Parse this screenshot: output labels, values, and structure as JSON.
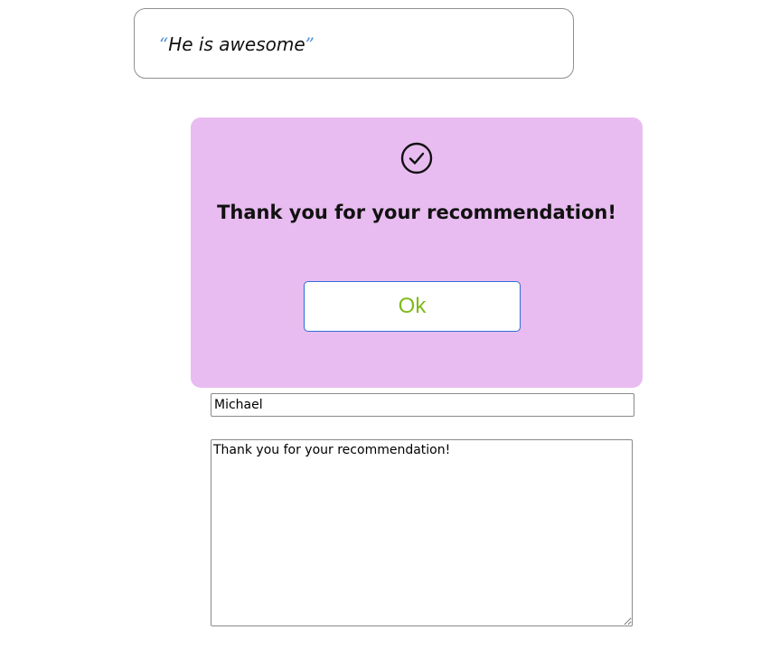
{
  "quote": {
    "open_mark": "“",
    "text": "He is awesome",
    "close_mark": "”"
  },
  "modal": {
    "icon": "check-circle-icon",
    "title": "Thank you for your recommendation!",
    "ok_label": "Ok"
  },
  "form": {
    "name_value": "Michael",
    "message_value": "Thank you for your recommendation!"
  },
  "colors": {
    "modal_background": "#e8bcf0",
    "ok_text": "#7fba1a",
    "ok_border": "#2f6fd8",
    "quote_marks": "#4d8fd6"
  }
}
